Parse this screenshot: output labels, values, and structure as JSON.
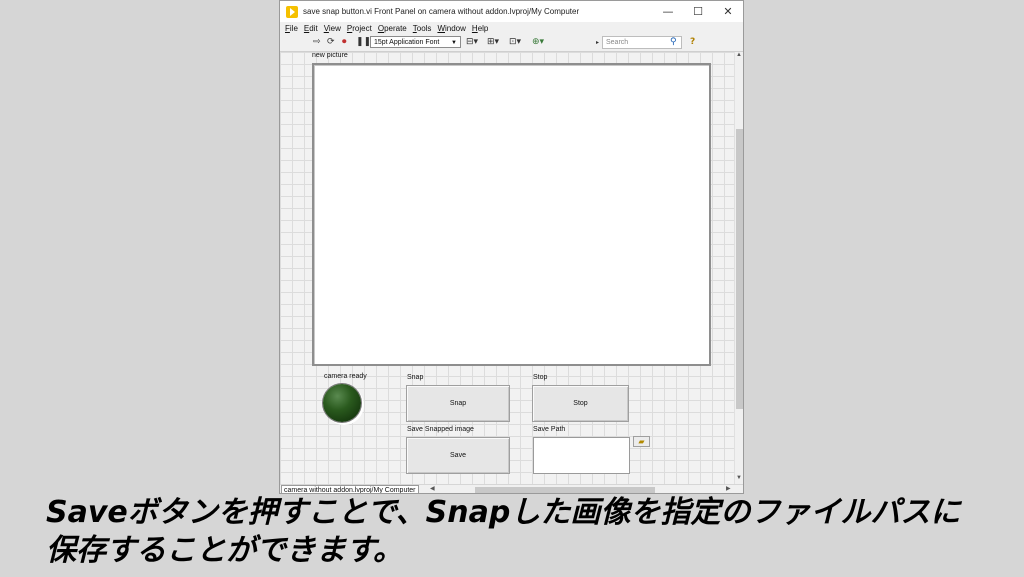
{
  "window": {
    "title": "save snap button.vi Front Panel on camera without addon.lvproj/My Computer",
    "controls": {
      "minimize": "—",
      "maximize": "☐",
      "close": "✕"
    }
  },
  "menu": [
    "File",
    "Edit",
    "View",
    "Project",
    "Operate",
    "Tools",
    "Window",
    "Help"
  ],
  "toolbar": {
    "font": "15pt Application Font",
    "search_placeholder": "Search",
    "help": "?",
    "search_icon": "magnifier-icon"
  },
  "panel": {
    "picture": {
      "label": "new picture"
    },
    "led": {
      "label": "camera ready",
      "state": "off",
      "color": "#2a5a1e"
    },
    "snap": {
      "label": "Snap",
      "text": "Snap"
    },
    "stop": {
      "label": "Stop",
      "text": "Stop"
    },
    "save": {
      "label": "Save Snapped image",
      "text": "Save"
    },
    "save_path": {
      "label": "Save Path",
      "value": ""
    }
  },
  "status": {
    "path": "camera without addon.lvproj/My Computer"
  },
  "caption": {
    "line1": "Saveボタンを押すことで、Snapした画像を指定のファイルパスに",
    "line2": "保存することができます。"
  }
}
